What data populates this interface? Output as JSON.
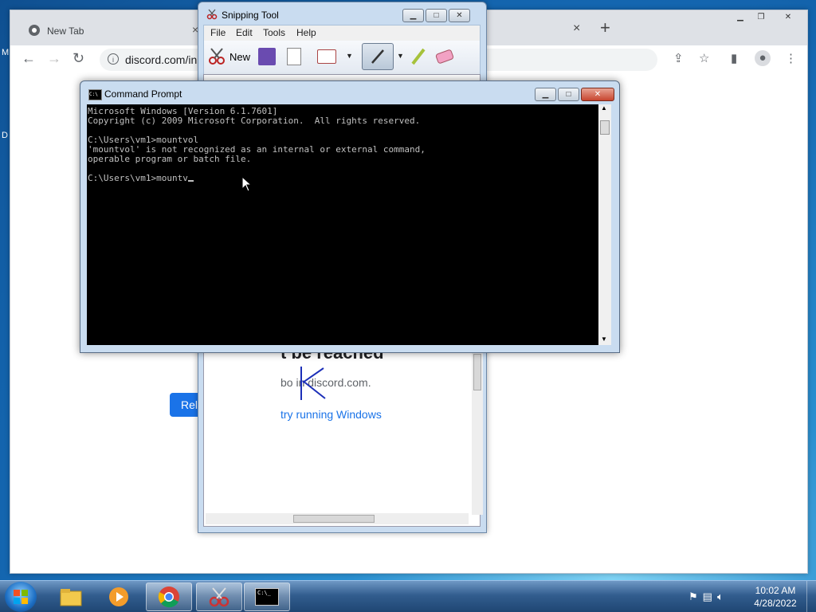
{
  "chrome": {
    "tab_title": "New Tab",
    "url": "discord.com/in",
    "tab_close": "×",
    "new_tab": "+"
  },
  "chrome_page": {
    "reload_label": "Rel"
  },
  "snipping_tool": {
    "title": "Snipping Tool",
    "menu": [
      "File",
      "Edit",
      "Tools",
      "Help"
    ],
    "new_label": "New",
    "captured": {
      "heading": "t be reached",
      "line": "bo in discord.com.",
      "link": "try running Windows",
      "annotation_letter": "K"
    }
  },
  "cmd": {
    "title": "Command Prompt",
    "lines": [
      "Microsoft Windows [Version 6.1.7601]",
      "Copyright (c) 2009 Microsoft Corporation.  All rights reserved.",
      "",
      "C:\\Users\\vm1>mountvol",
      "'mountvol' is not recognized as an internal or external command,",
      "operable program or batch file.",
      "",
      "C:\\Users\\vm1>mountv"
    ]
  },
  "taskbar": {
    "time": "10:02 AM",
    "date": "4/28/2022",
    "apps": [
      "windows-explorer",
      "media-player",
      "chrome",
      "snipping-tool",
      "command-prompt"
    ]
  },
  "colors": {
    "chrome_blue": "#1a73e8",
    "console_bg": "#000000",
    "console_fg": "#c0c0c0",
    "annotation_pen": "#1c2fb8"
  }
}
